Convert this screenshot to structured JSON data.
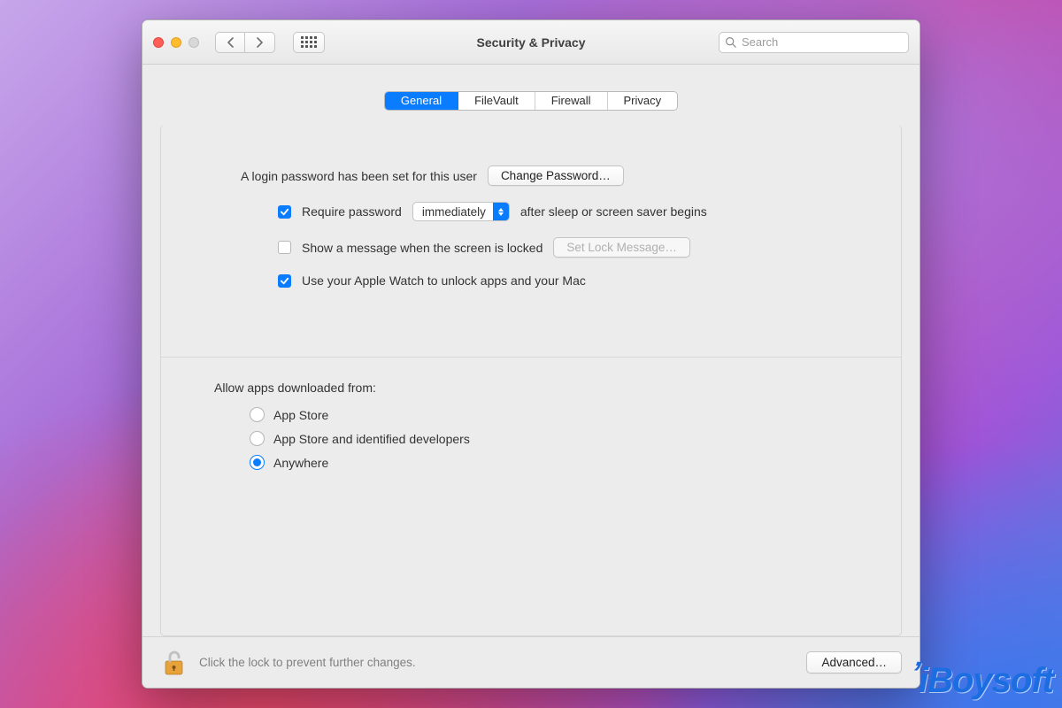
{
  "window": {
    "title": "Security & Privacy",
    "search_placeholder": "Search"
  },
  "tabs": [
    {
      "label": "General",
      "active": true
    },
    {
      "label": "FileVault",
      "active": false
    },
    {
      "label": "Firewall",
      "active": false
    },
    {
      "label": "Privacy",
      "active": false
    }
  ],
  "general": {
    "login_password_text": "A login password has been set for this user",
    "change_password_btn": "Change Password…",
    "require_password_checked": true,
    "require_password_pre": "Require password",
    "require_password_select": "immediately",
    "require_password_post": "after sleep or screen saver begins",
    "show_message_checked": false,
    "show_message_label": "Show a message when the screen is locked",
    "set_lock_message_btn": "Set Lock Message…",
    "apple_watch_checked": true,
    "apple_watch_label": "Use your Apple Watch to unlock apps and your Mac"
  },
  "gatekeeper": {
    "title": "Allow apps downloaded from:",
    "options": [
      {
        "label": "App Store",
        "checked": false
      },
      {
        "label": "App Store and identified developers",
        "checked": false
      },
      {
        "label": "Anywhere",
        "checked": true
      }
    ]
  },
  "footer": {
    "lock_text": "Click the lock to prevent further changes.",
    "advanced_btn": "Advanced…"
  },
  "watermark": "iBoysoft"
}
